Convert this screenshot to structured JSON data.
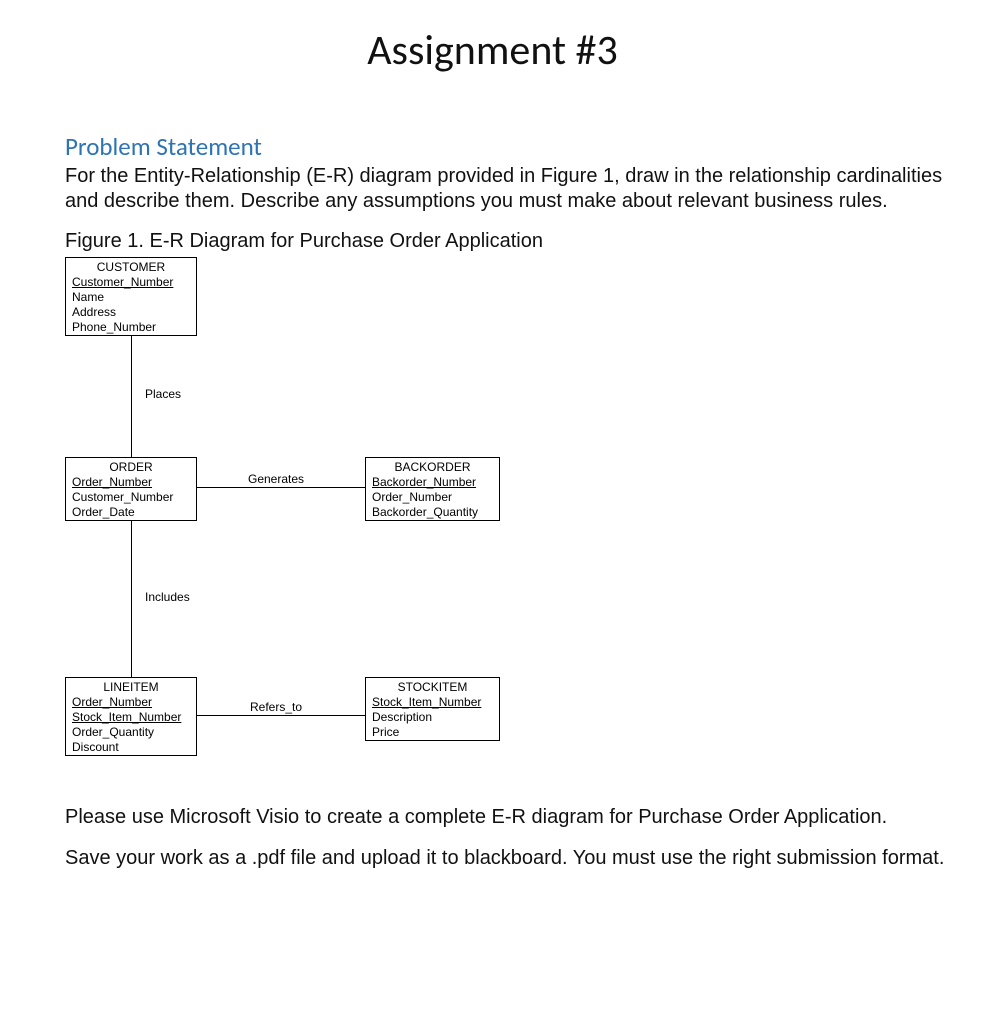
{
  "title": "Assignment #3",
  "section_heading": "Problem Statement",
  "paragraph1": "For the Entity-Relationship (E-R) diagram provided in Figure 1, draw in the relationship cardinalities and describe them. Describe any assumptions you must make about relevant business rules.",
  "figure_caption": "Figure 1. E-R Diagram for Purchase Order Application",
  "paragraph2": "Please use Microsoft Visio to create a complete E-R diagram for Purchase Order Application.",
  "paragraph3": "Save your work as a .pdf file and upload it to blackboard. You must use the right submission format.",
  "relationships": {
    "places": "Places",
    "generates": "Generates",
    "includes": "Includes",
    "refers_to": "Refers_to"
  },
  "entities": {
    "customer": {
      "name": "CUSTOMER",
      "key": "Customer_Number",
      "attrs": [
        "Name",
        "Address",
        "Phone_Number"
      ]
    },
    "order": {
      "name": "ORDER",
      "key": "Order_Number",
      "attrs": [
        "Customer_Number",
        "Order_Date"
      ]
    },
    "backorder": {
      "name": "BACKORDER",
      "key": "Backorder_Number",
      "attrs": [
        "Order_Number",
        "Backorder_Quantity"
      ]
    },
    "lineitem": {
      "name": "LINEITEM",
      "keys": [
        "Order_Number",
        "Stock_Item_Number"
      ],
      "attrs": [
        "Order_Quantity",
        "Discount"
      ]
    },
    "stockitem": {
      "name": "STOCKITEM",
      "key": "Stock_Item_Number",
      "attrs": [
        "Description",
        "Price"
      ]
    }
  }
}
